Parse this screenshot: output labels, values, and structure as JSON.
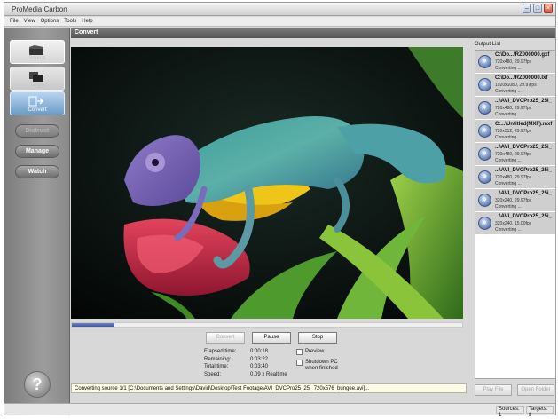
{
  "app": {
    "title": "ProMedia Carbon",
    "window_buttons": [
      "minimize",
      "maximize",
      "close"
    ]
  },
  "menu": [
    "File",
    "View",
    "Options",
    "Tools",
    "Help"
  ],
  "sidebar": {
    "tiles": [
      {
        "label": "Source",
        "icon": "folder-icon",
        "active": false
      },
      {
        "label": "Target",
        "icon": "target-files-icon",
        "active": false
      },
      {
        "label": "Convert",
        "icon": "convert-icon",
        "active": true
      }
    ],
    "buttons": [
      "Distrust",
      "Manage",
      "Watch"
    ],
    "help": "?"
  },
  "main": {
    "header": "Convert",
    "preview_image": "chameleon-on-tulips-frame",
    "progress": 0.11,
    "controls": {
      "convert": "Convert",
      "pause": "Pause",
      "stop": "Stop"
    },
    "stats": [
      {
        "label": "Elapsed time:",
        "value": "0:00:18"
      },
      {
        "label": "Remaining:",
        "value": "0:03:22"
      },
      {
        "label": "Total time:",
        "value": "0:03:40"
      },
      {
        "label": "Speed:",
        "value": "0.09 x Realtime"
      }
    ],
    "checkboxes": [
      {
        "label": "Preview",
        "checked": false
      },
      {
        "label": "Shutdown PC when finished",
        "checked": false
      }
    ],
    "status_line": "Converting source 1/1 [C:\\Documents and Settings\\David\\Desktop\\Test Footage\\AVI_DVCPro25_25i_720x576_bungee.avi]..."
  },
  "output_list": {
    "header": "Output List",
    "items": [
      {
        "name": "C:\\Do...\\RZ000000.gxf",
        "meta": "720x480, 29.97fps",
        "status": "Converting ..."
      },
      {
        "name": "C:\\Do...\\RZ000000.lxf",
        "meta": "1920x1080, 29.97fps",
        "status": "Converting ..."
      },
      {
        "name": "...\\AVI_DVCPro25_25i_",
        "meta": "720x480, 29.97fps",
        "status": "Converting ..."
      },
      {
        "name": "C:...\\Untitled(MXF).mxf",
        "meta": "720x512, 29.97fps",
        "status": "Converting ..."
      },
      {
        "name": "...\\AVI_DVCPro25_25i_",
        "meta": "720x480, 29.97fps",
        "status": "Converting ..."
      },
      {
        "name": "...\\AVI_DVCPro25_25i_",
        "meta": "720x480, 29.97fps",
        "status": "Converting ..."
      },
      {
        "name": "...\\AVI_DVCPro25_25i_",
        "meta": "320x240, 29.97fps",
        "status": "Converting ..."
      },
      {
        "name": "...\\AVI_DVCPro25_25i_",
        "meta": "320x240, 15.00fps",
        "status": "Converting ..."
      }
    ],
    "play_file": "Play File",
    "open_folder": "Open Folder"
  },
  "statusbar": {
    "sources": "Sources: 1",
    "targets": "Targets: 8"
  }
}
